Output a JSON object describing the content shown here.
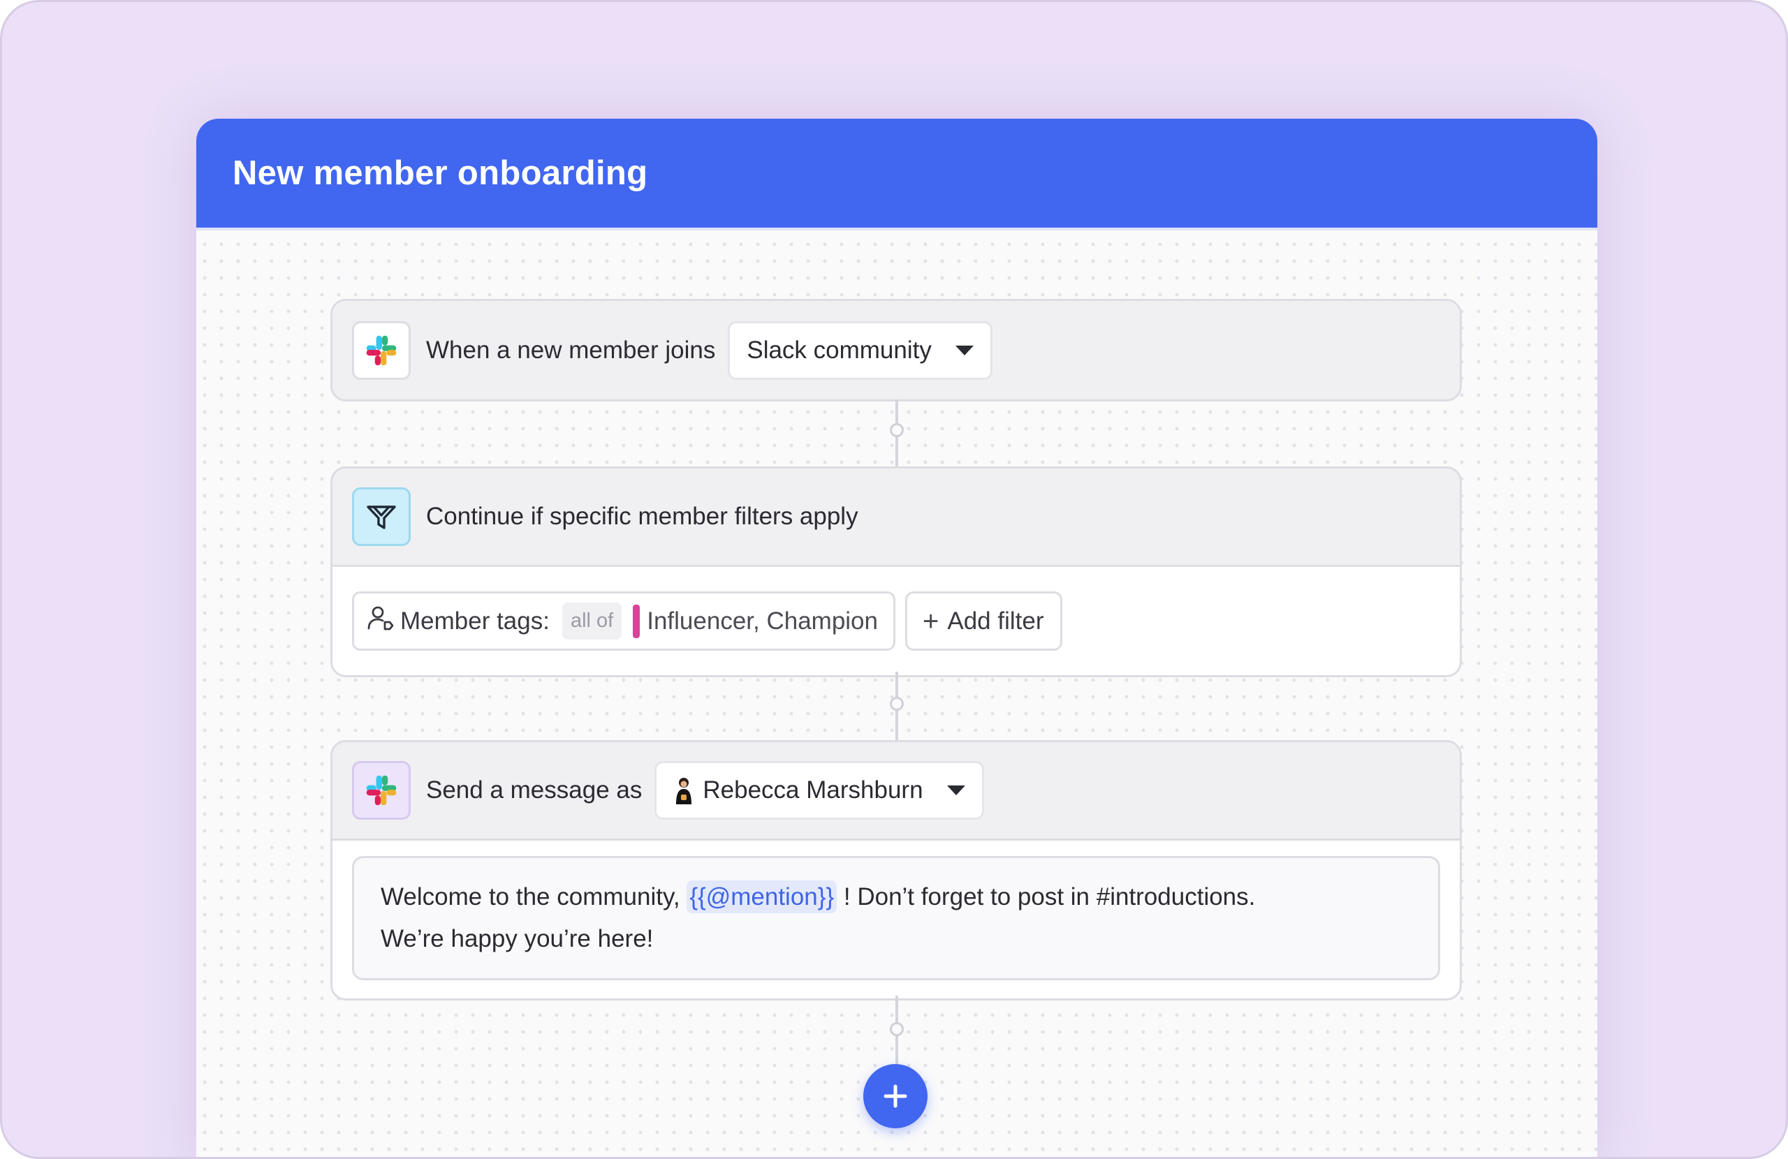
{
  "colors": {
    "accent": "#4166f0",
    "mention_bg": "#e3e9fb",
    "tag_color": "#d8449a",
    "filter_icon_bg": "#cdeefb"
  },
  "workflow": {
    "title": "New member onboarding"
  },
  "trigger": {
    "icon": "slack-logo-icon",
    "text": "When a new member joins",
    "source_value": "Slack community"
  },
  "filter": {
    "icon": "filter-funnel-icon",
    "text": "Continue if specific member filters apply",
    "chip": {
      "icon": "user-tag-icon",
      "label": "Member tags:",
      "mode": "all of",
      "values": "Influencer, Champion"
    },
    "add_filter_label": "Add filter"
  },
  "action": {
    "icon": "slack-logo-icon",
    "text": "Send a message as",
    "sender": "Rebecca Marshburn",
    "message": {
      "before": "Welcome to the community,",
      "mention": "{{@mention}}",
      "after": "! Don’t forget to post in #introductions.",
      "line2": "We’re happy you’re here!"
    }
  },
  "add_step_icon": "plus-icon"
}
